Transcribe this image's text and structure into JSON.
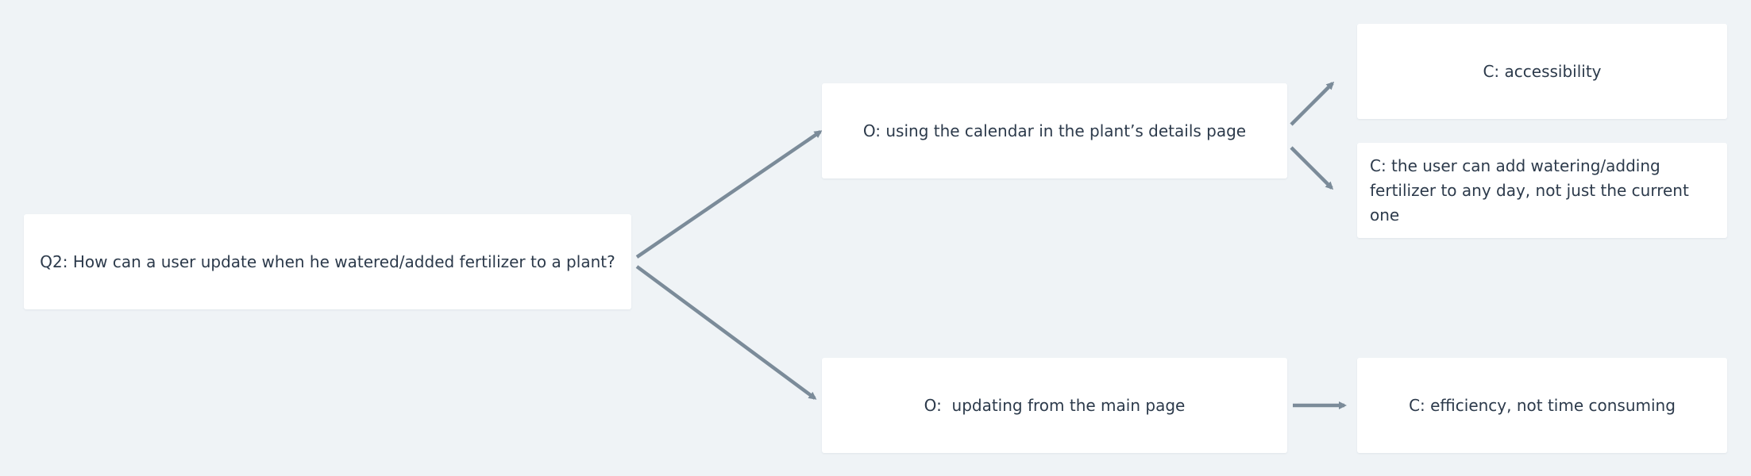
{
  "diagram": {
    "question": "Q2: How can a user update when he watered/added fertilizer to a plant?",
    "options": [
      {
        "label": "O: using the calendar in the plant’s details page",
        "considerations": [
          "C: accessibility",
          "C: the user can add watering/adding fertilizer to any day, not just the current one"
        ]
      },
      {
        "label": "O:  updating from the main page",
        "considerations": [
          "C: efficiency, not time consuming"
        ]
      }
    ]
  },
  "colors": {
    "background": "#eff3f6",
    "node_fill": "#ffffff",
    "connector": "#7b8b99",
    "text": "#2c3a4b"
  }
}
